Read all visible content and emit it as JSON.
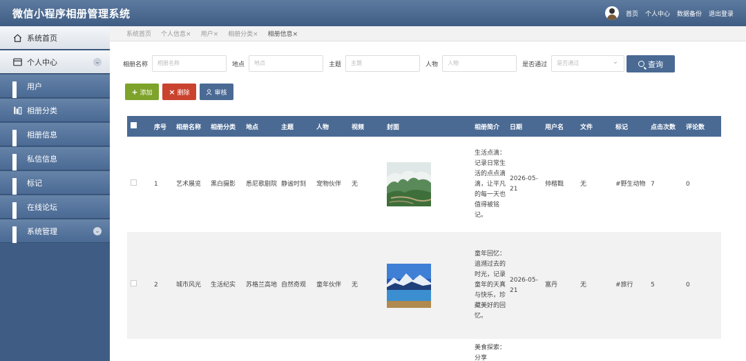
{
  "app": {
    "title": "微信小程序相册管理系统"
  },
  "topnav": {
    "links": [
      "首页",
      "个人中心",
      "数据备份",
      "退出登录"
    ]
  },
  "sidebar": {
    "items": [
      {
        "label": "系统首页",
        "icon": "home-icon",
        "expandable": false
      },
      {
        "label": "个人中心",
        "icon": "card-icon",
        "expandable": true
      },
      {
        "label": "用户",
        "icon": "grid-icon",
        "expandable": false
      },
      {
        "label": "相册分类",
        "icon": "chart-icon",
        "expandable": false
      },
      {
        "label": "相册信息",
        "icon": "grid-icon",
        "expandable": false
      },
      {
        "label": "私信信息",
        "icon": "grid-icon",
        "expandable": false
      },
      {
        "label": "标记",
        "icon": "grid-icon",
        "expandable": false
      },
      {
        "label": "在线论坛",
        "icon": "grid-icon",
        "expandable": false
      },
      {
        "label": "系统管理",
        "icon": "grid-icon",
        "expandable": true
      }
    ]
  },
  "breadcrumb": {
    "tabs": [
      "系统首页",
      "个人信息×",
      "用户×",
      "相册分类×",
      "相册信息×"
    ]
  },
  "search": {
    "fields": [
      {
        "label": "相册名称",
        "placeholder": "相册名称"
      },
      {
        "label": "地点",
        "placeholder": "地点"
      },
      {
        "label": "主题",
        "placeholder": "主题"
      },
      {
        "label": "人物",
        "placeholder": "人物"
      },
      {
        "label": "是否通过",
        "placeholder": "是否通过"
      }
    ],
    "query_label": "查询"
  },
  "actions": {
    "add": "添加",
    "delete": "删除",
    "audit": "审核"
  },
  "table": {
    "headers": [
      "序号",
      "相册名称",
      "相册分类",
      "地点",
      "主题",
      "人物",
      "视频",
      "封面",
      "相册简介",
      "日期",
      "用户名",
      "文件",
      "标记",
      "点击次数",
      "评论数"
    ],
    "rows": [
      {
        "index": "1",
        "name": "艺术展览",
        "category": "黑白摄影",
        "place": "悉尼歌剧院",
        "theme": "静谧时刻",
        "people": "宠物伙伴",
        "video": "无",
        "intro": "生活点滴：记录日常生活的点点滴滴，让平凡的每一天也值得被铭记。",
        "date": "2026-05-21",
        "user": "帅楷戡",
        "file": "无",
        "tag": "#野生动物",
        "clicks": "7",
        "comments": "0"
      },
      {
        "index": "2",
        "name": "城市风光",
        "category": "生活纪实",
        "place": "苏格兰高地",
        "theme": "自然奇观",
        "people": "童年伙伴",
        "video": "无",
        "intro": "童年回忆：追溯过去的时光，记录童年的天真与快乐，珍藏美好的回忆。",
        "date": "2026-05-21",
        "user": "富丹",
        "file": "无",
        "tag": "#旅行",
        "clicks": "5",
        "comments": "0"
      },
      {
        "intro": "美食探索：分享"
      }
    ]
  },
  "colors": {
    "primary": "#4a6a94",
    "add": "#7ea32a",
    "delete": "#c9432f"
  }
}
